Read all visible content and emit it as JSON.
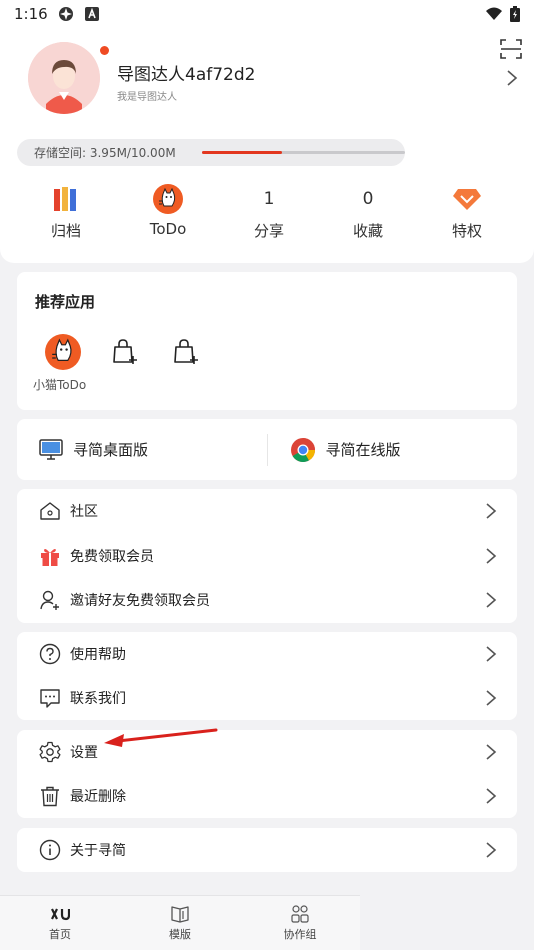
{
  "status_bar": {
    "time": "1:16"
  },
  "profile": {
    "username": "导图达人4af72d2",
    "subtitle": "我是导图达人",
    "storage_text": "存储空间: 3.95M/10.00M",
    "storage_fraction": 0.395
  },
  "stats": [
    {
      "top": "",
      "label": "归档",
      "icon": "archive-books-icon"
    },
    {
      "top": "",
      "label": "ToDo",
      "icon": "todo-cat-icon"
    },
    {
      "top": "1",
      "label": "分享"
    },
    {
      "top": "0",
      "label": "收藏"
    },
    {
      "top": "",
      "label": "特权",
      "icon": "privilege-gem-icon"
    }
  ],
  "recommended": {
    "title": "推荐应用",
    "apps": [
      {
        "label": "小猫ToDo"
      }
    ]
  },
  "versions": {
    "desktop": "寻简桌面版",
    "online": "寻简在线版"
  },
  "menu_group1": [
    {
      "label": "社区",
      "icon": "community-house-icon"
    },
    {
      "label": "免费领取会员",
      "icon": "gift-icon"
    },
    {
      "label": "邀请好友免费领取会员",
      "icon": "invite-user-icon"
    }
  ],
  "menu_group2": [
    {
      "label": "使用帮助",
      "icon": "help-icon"
    },
    {
      "label": "联系我们",
      "icon": "contact-chat-icon"
    }
  ],
  "menu_group3": [
    {
      "label": "设置",
      "icon": "gear-icon"
    },
    {
      "label": "最近删除",
      "icon": "trash-icon"
    }
  ],
  "menu_group4": [
    {
      "label": "关于寻简",
      "icon": "info-icon"
    }
  ],
  "tabs": [
    {
      "label": "首页",
      "icon": "home-logo-icon"
    },
    {
      "label": "模版",
      "icon": "template-icon"
    },
    {
      "label": "协作组",
      "icon": "team-icon"
    }
  ],
  "colors": {
    "accent_red": "#e2371f",
    "notify_dot": "#ef4b23",
    "gem": "#f4793b",
    "annotation_arrow": "#d9211c"
  }
}
